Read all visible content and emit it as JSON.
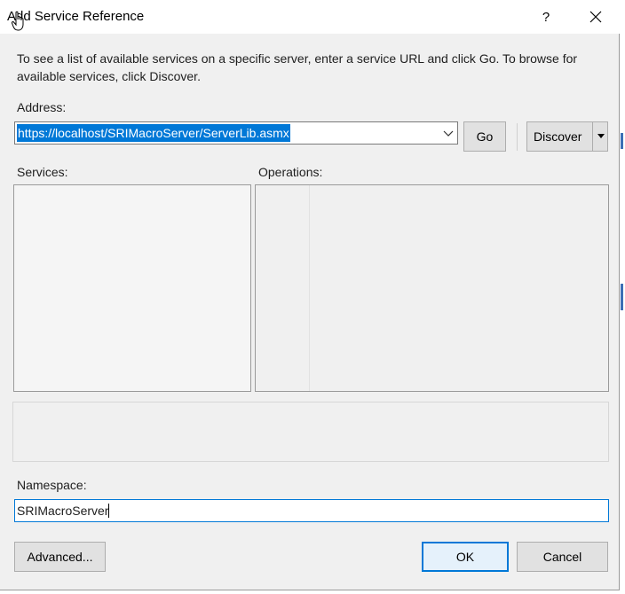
{
  "window": {
    "title": "Add Service Reference",
    "help_label": "?"
  },
  "description": "To see a list of available services on a specific server, enter a service URL and click Go. To browse for available services, click Discover.",
  "address": {
    "label": "Address:",
    "value": "https://localhost/SRIMacroServer/ServerLib.asmx"
  },
  "buttons": {
    "go": "Go",
    "discover": "Discover",
    "advanced": "Advanced...",
    "ok": "OK",
    "cancel": "Cancel"
  },
  "services": {
    "label": "Services:"
  },
  "operations": {
    "label": "Operations:"
  },
  "namespace": {
    "label": "Namespace:",
    "value": "SRIMacroServer"
  },
  "colors": {
    "accent": "#0078d7",
    "dialog_bg": "#f0f0f0"
  }
}
